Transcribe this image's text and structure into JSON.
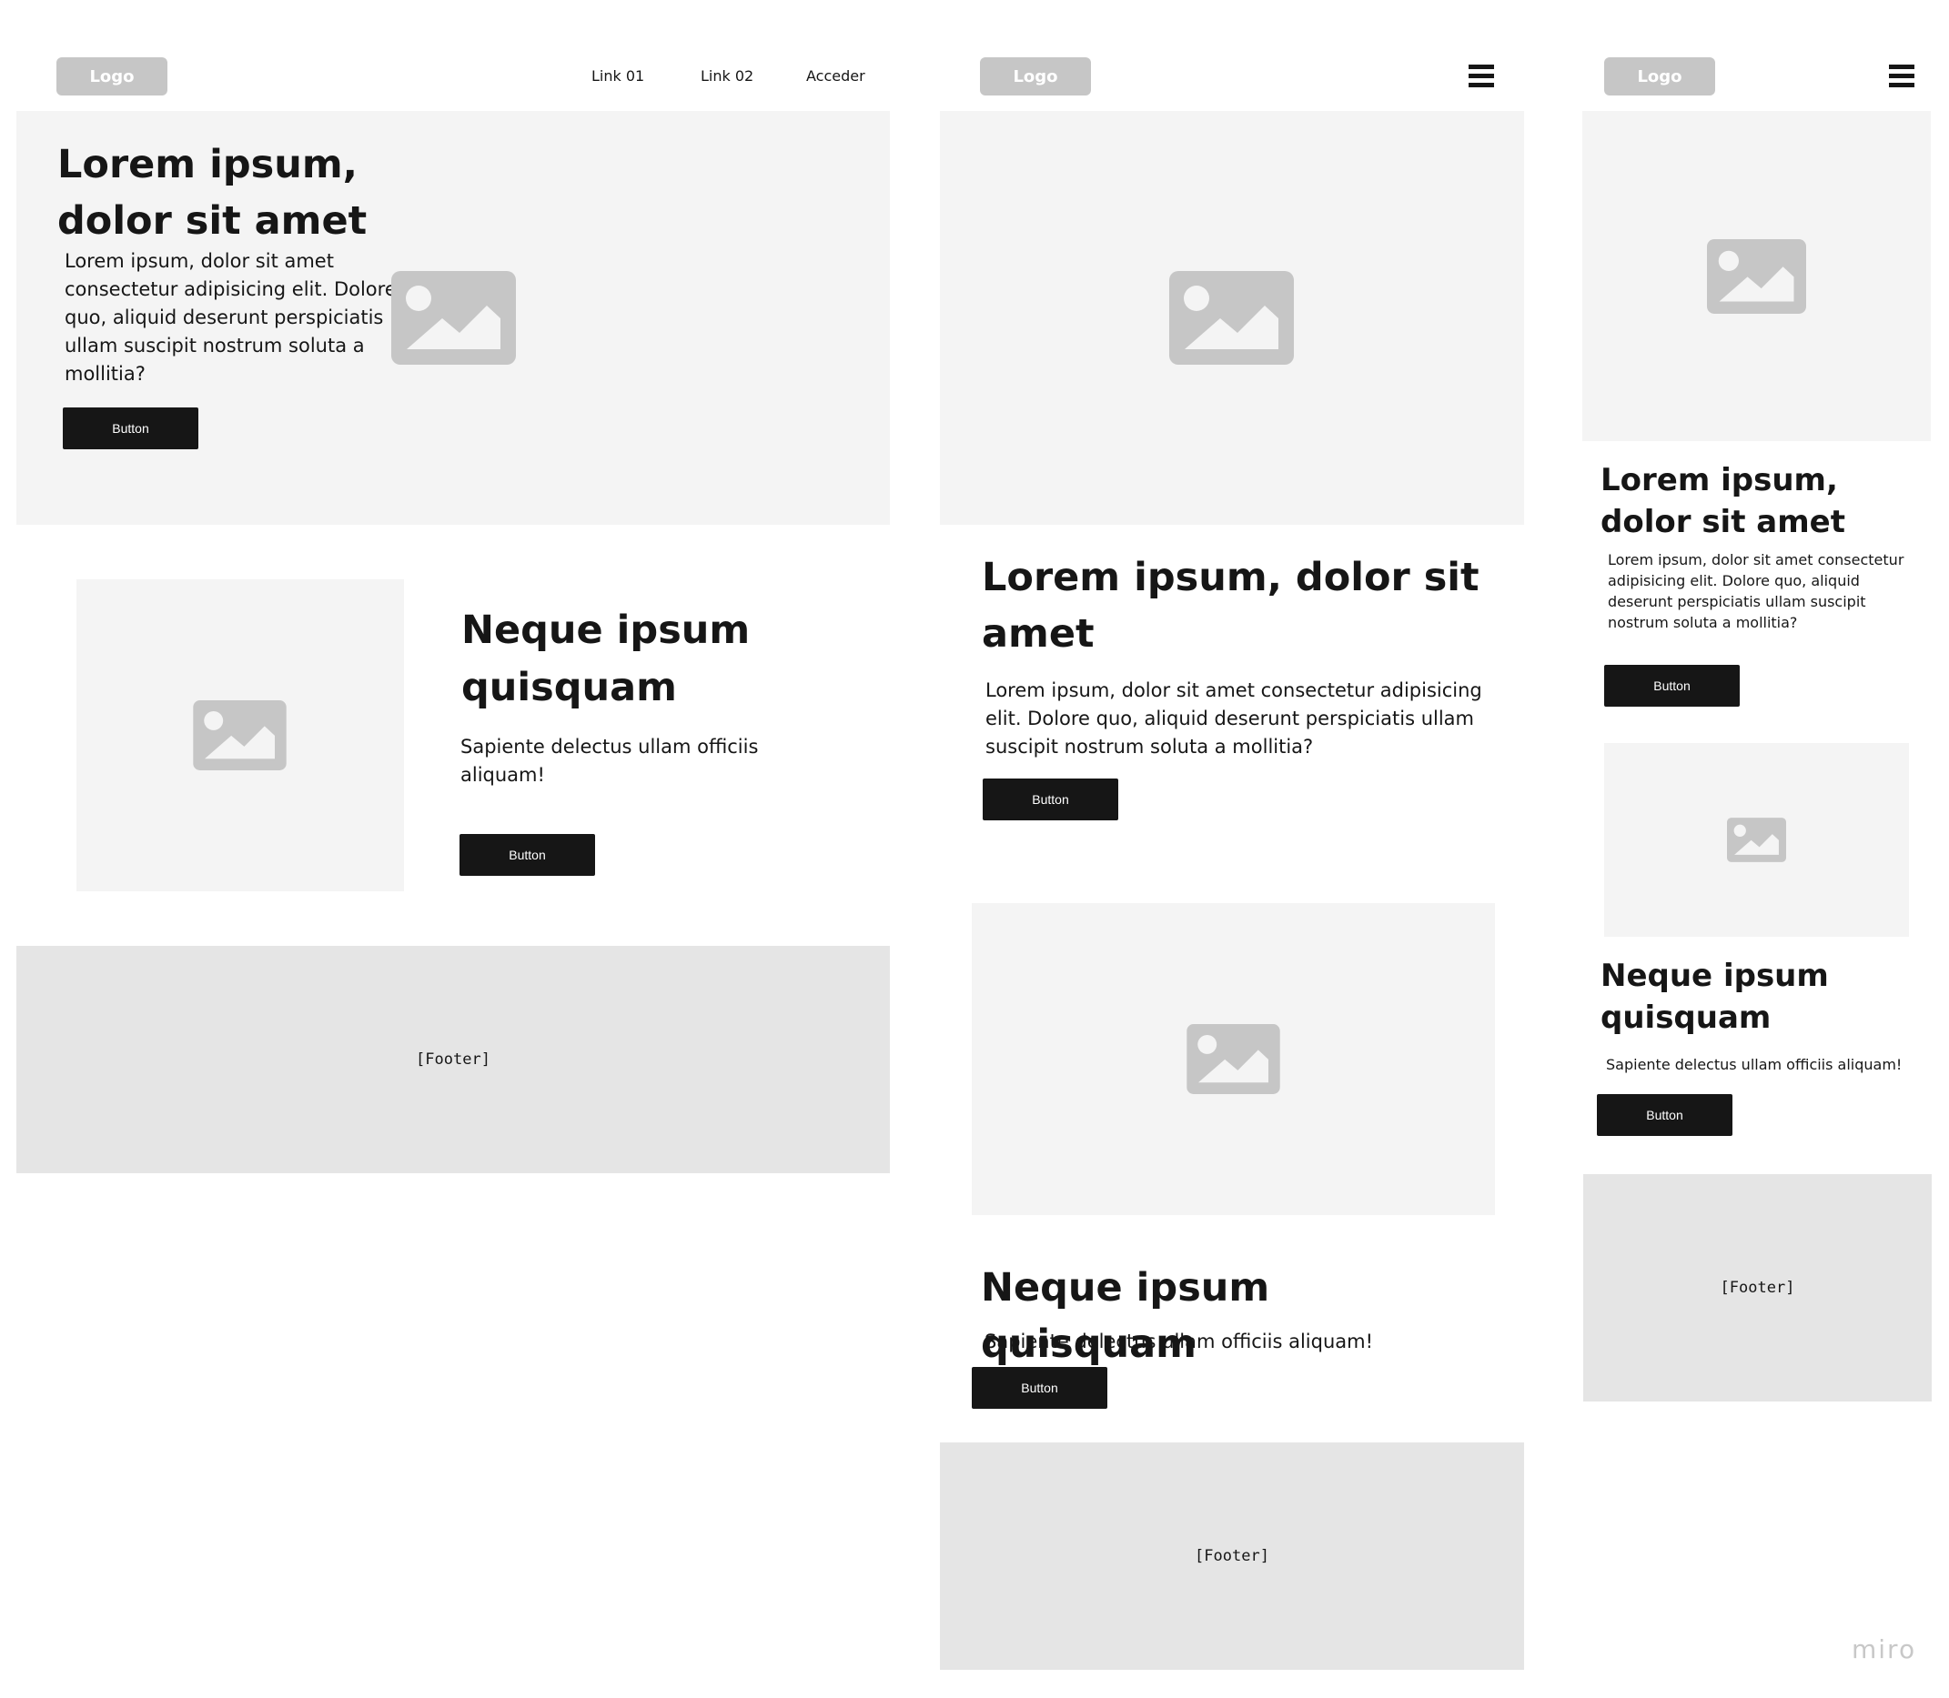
{
  "desktop": {
    "logo": "Logo",
    "nav_links": [
      "Link 01",
      "Link 02",
      "Acceder"
    ],
    "hero": {
      "title": "Lorem ipsum, dolor sit amet",
      "body": "Lorem ipsum, dolor sit amet consectetur adipisicing elit. Dolore quo, aliquid deserunt perspiciatis ullam suscipit nostrum soluta a mollitia?",
      "button": "Button"
    },
    "feature": {
      "title": "Neque ipsum quisquam",
      "body": "Sapiente delectus ullam officiis aliquam!",
      "button": "Button"
    },
    "footer": "[Footer]"
  },
  "tablet": {
    "logo": "Logo",
    "menu_icon": "hamburger-menu-icon",
    "hero": {
      "title": "Lorem ipsum, dolor sit amet",
      "body": "Lorem ipsum, dolor sit amet consectetur adipisicing elit. Dolore quo, aliquid deserunt perspiciatis ullam suscipit nostrum soluta a mollitia?",
      "button": "Button"
    },
    "feature": {
      "title": "Neque ipsum quisquam",
      "body": "Sapiente delectus ullam officiis aliquam!",
      "button": "Button"
    },
    "footer": "[Footer]"
  },
  "mobile": {
    "logo": "Logo",
    "menu_icon": "hamburger-menu-icon",
    "hero": {
      "title": "Lorem ipsum, dolor sit amet",
      "body": "Lorem ipsum, dolor sit amet consectetur adipisicing elit. Dolore quo, aliquid deserunt perspiciatis ullam suscipit nostrum soluta a mollitia?",
      "button": "Button"
    },
    "feature": {
      "title": "Neque ipsum quisquam",
      "body": "Sapiente delectus ullam officiis aliquam!",
      "button": "Button"
    },
    "footer": "[Footer]"
  },
  "watermark": "miro",
  "colors": {
    "panel": "#f4f4f4",
    "footer": "#e5e5e5",
    "placeholder": "#c6c6c6",
    "button": "#161616",
    "text": "#161616"
  }
}
